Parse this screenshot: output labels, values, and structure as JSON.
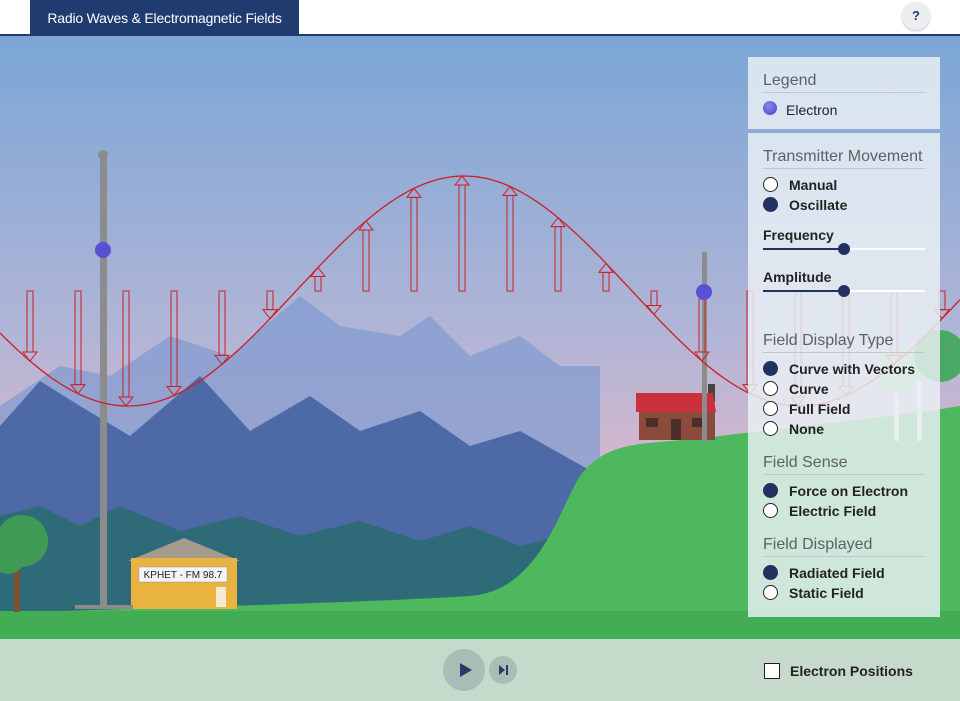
{
  "app": {
    "title": "Radio Waves & Electromagnetic Fields",
    "help_label": "?"
  },
  "scene": {
    "station_sign": "KPHET - FM 98.7"
  },
  "panel": {
    "legend": {
      "title": "Legend",
      "electron_label": "Electron"
    },
    "transmitter_movement": {
      "title": "Transmitter Movement",
      "options": [
        "Manual",
        "Oscillate"
      ],
      "selected": "Oscillate",
      "frequency_label": "Frequency",
      "frequency_value": 0.5,
      "amplitude_label": "Amplitude",
      "amplitude_value": 0.5
    },
    "field_display_type": {
      "title": "Field Display Type",
      "options": [
        "Curve with Vectors",
        "Curve",
        "Full Field",
        "None"
      ],
      "selected": "Curve with Vectors"
    },
    "field_sense": {
      "title": "Field Sense",
      "options": [
        "Force on Electron",
        "Electric Field"
      ],
      "selected": "Force on Electron"
    },
    "field_displayed": {
      "title": "Field Displayed",
      "options": [
        "Radiated Field",
        "Static Field"
      ],
      "selected": "Radiated Field"
    }
  },
  "controls": {
    "electron_positions_label": "Electron Positions",
    "electron_positions_checked": false
  },
  "colors": {
    "header": "#1f3b6f",
    "field_curve": "#cc1f24",
    "electron": "#5a50d6",
    "hill": "#4db85e",
    "selected_radio": "#22315f"
  }
}
